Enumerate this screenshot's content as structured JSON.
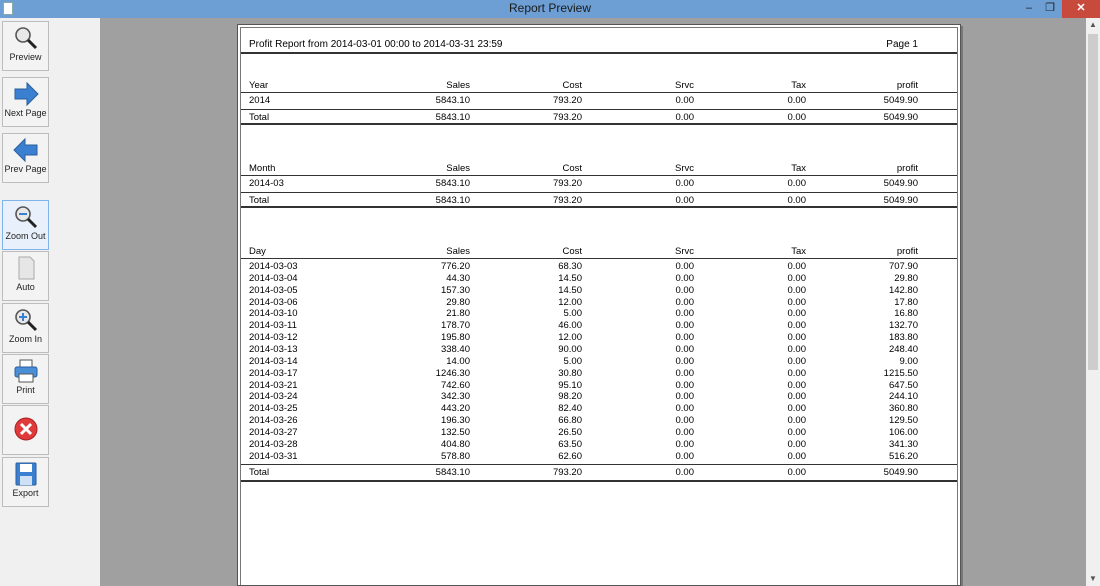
{
  "window": {
    "title": "Report Preview",
    "min": "‒",
    "max": "❐",
    "close": "✕"
  },
  "toolbar": {
    "preview": "Preview",
    "next_page": "Next Page",
    "prev_page": "Prev Page",
    "zoom_out": "Zoom Out",
    "auto": "Auto",
    "zoom_in": "Zoom In",
    "print": "Print",
    "export": "Export"
  },
  "report": {
    "heading": "Profit Report from 2014-03-01 00:00 to 2014-03-31 23:59",
    "page_label": "Page 1",
    "year_section": {
      "columns": [
        "Year",
        "Sales",
        "Cost",
        "Srvc",
        "Tax",
        "profit"
      ],
      "rows": [
        [
          "2014",
          "5843.10",
          "793.20",
          "0.00",
          "0.00",
          "5049.90"
        ]
      ],
      "total": [
        "Total",
        "5843.10",
        "793.20",
        "0.00",
        "0.00",
        "5049.90"
      ]
    },
    "month_section": {
      "columns": [
        "Month",
        "Sales",
        "Cost",
        "Srvc",
        "Tax",
        "profit"
      ],
      "rows": [
        [
          "2014-03",
          "5843.10",
          "793.20",
          "0.00",
          "0.00",
          "5049.90"
        ]
      ],
      "total": [
        "Total",
        "5843.10",
        "793.20",
        "0.00",
        "0.00",
        "5049.90"
      ]
    },
    "day_section": {
      "columns": [
        "Day",
        "Sales",
        "Cost",
        "Srvc",
        "Tax",
        "profit"
      ],
      "rows": [
        [
          "2014-03-03",
          "776.20",
          "68.30",
          "0.00",
          "0.00",
          "707.90"
        ],
        [
          "2014-03-04",
          "44.30",
          "14.50",
          "0.00",
          "0.00",
          "29.80"
        ],
        [
          "2014-03-05",
          "157.30",
          "14.50",
          "0.00",
          "0.00",
          "142.80"
        ],
        [
          "2014-03-06",
          "29.80",
          "12.00",
          "0.00",
          "0.00",
          "17.80"
        ],
        [
          "2014-03-10",
          "21.80",
          "5.00",
          "0.00",
          "0.00",
          "16.80"
        ],
        [
          "2014-03-11",
          "178.70",
          "46.00",
          "0.00",
          "0.00",
          "132.70"
        ],
        [
          "2014-03-12",
          "195.80",
          "12.00",
          "0.00",
          "0.00",
          "183.80"
        ],
        [
          "2014-03-13",
          "338.40",
          "90.00",
          "0.00",
          "0.00",
          "248.40"
        ],
        [
          "2014-03-14",
          "14.00",
          "5.00",
          "0.00",
          "0.00",
          "9.00"
        ],
        [
          "2014-03-17",
          "1246.30",
          "30.80",
          "0.00",
          "0.00",
          "1215.50"
        ],
        [
          "2014-03-21",
          "742.60",
          "95.10",
          "0.00",
          "0.00",
          "647.50"
        ],
        [
          "2014-03-24",
          "342.30",
          "98.20",
          "0.00",
          "0.00",
          "244.10"
        ],
        [
          "2014-03-25",
          "443.20",
          "82.40",
          "0.00",
          "0.00",
          "360.80"
        ],
        [
          "2014-03-26",
          "196.30",
          "66.80",
          "0.00",
          "0.00",
          "129.50"
        ],
        [
          "2014-03-27",
          "132.50",
          "26.50",
          "0.00",
          "0.00",
          "106.00"
        ],
        [
          "2014-03-28",
          "404.80",
          "63.50",
          "0.00",
          "0.00",
          "341.30"
        ],
        [
          "2014-03-31",
          "578.80",
          "62.60",
          "0.00",
          "0.00",
          "516.20"
        ]
      ],
      "total": [
        "Total",
        "5843.10",
        "793.20",
        "0.00",
        "0.00",
        "5049.90"
      ]
    }
  }
}
